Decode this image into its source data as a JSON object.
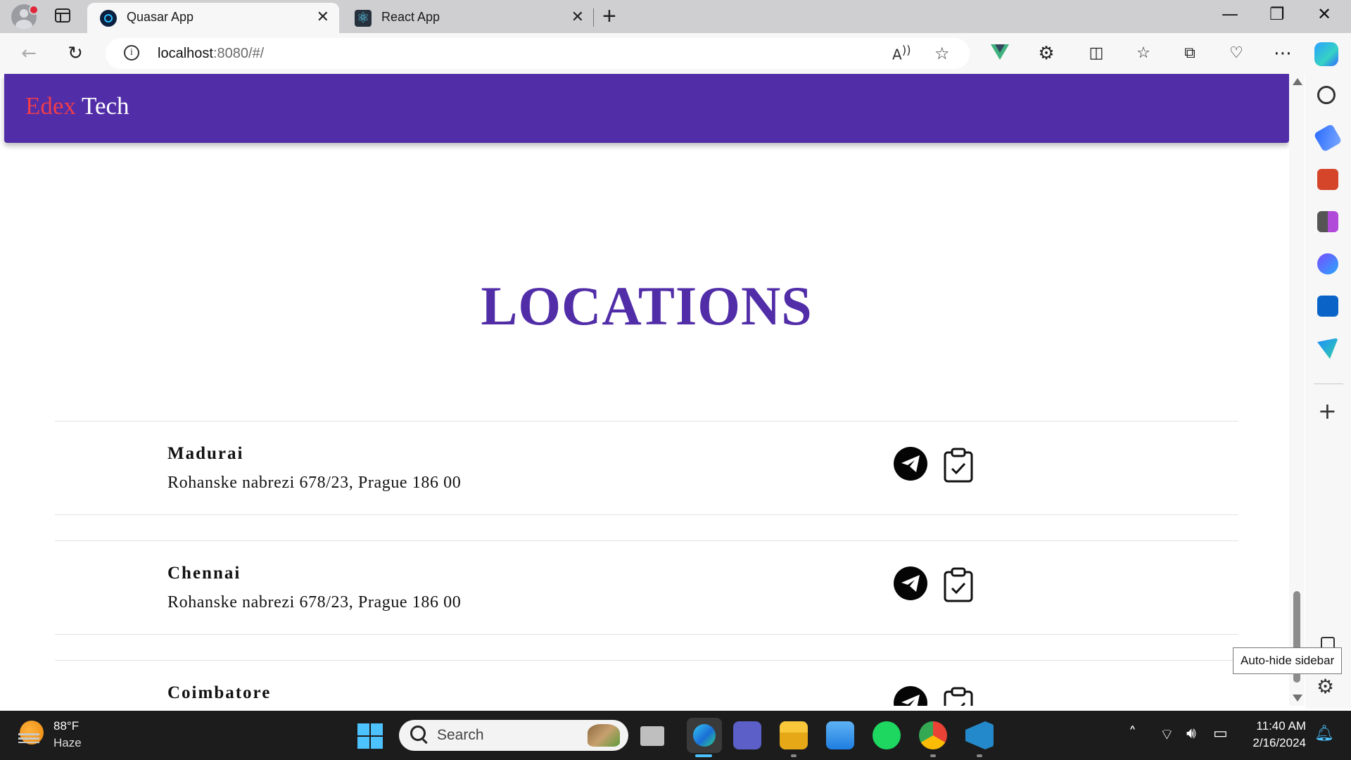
{
  "browser": {
    "tabs": [
      {
        "title": "Quasar App",
        "active": true
      },
      {
        "title": "React App",
        "active": false
      }
    ],
    "url_host": "localhost",
    "url_rest": ":8080/#/"
  },
  "sidebar": {
    "tooltip": "Auto-hide sidebar"
  },
  "app": {
    "brand_first": "Edex",
    "brand_second": "Tech",
    "heading": "LOCATIONS",
    "colors": {
      "primary": "#512da8",
      "brand_accent": "#ef3d4a"
    },
    "locations": [
      {
        "name": "Madurai",
        "address": "Rohanske nabrezi 678/23, Prague 186 00"
      },
      {
        "name": "Chennai",
        "address": "Rohanske nabrezi 678/23, Prague 186 00"
      },
      {
        "name": "Coimbatore",
        "address": ""
      }
    ]
  },
  "taskbar": {
    "temperature": "88°F",
    "condition": "Haze",
    "search_placeholder": "Search",
    "time": "11:40 AM",
    "date": "2/16/2024"
  }
}
